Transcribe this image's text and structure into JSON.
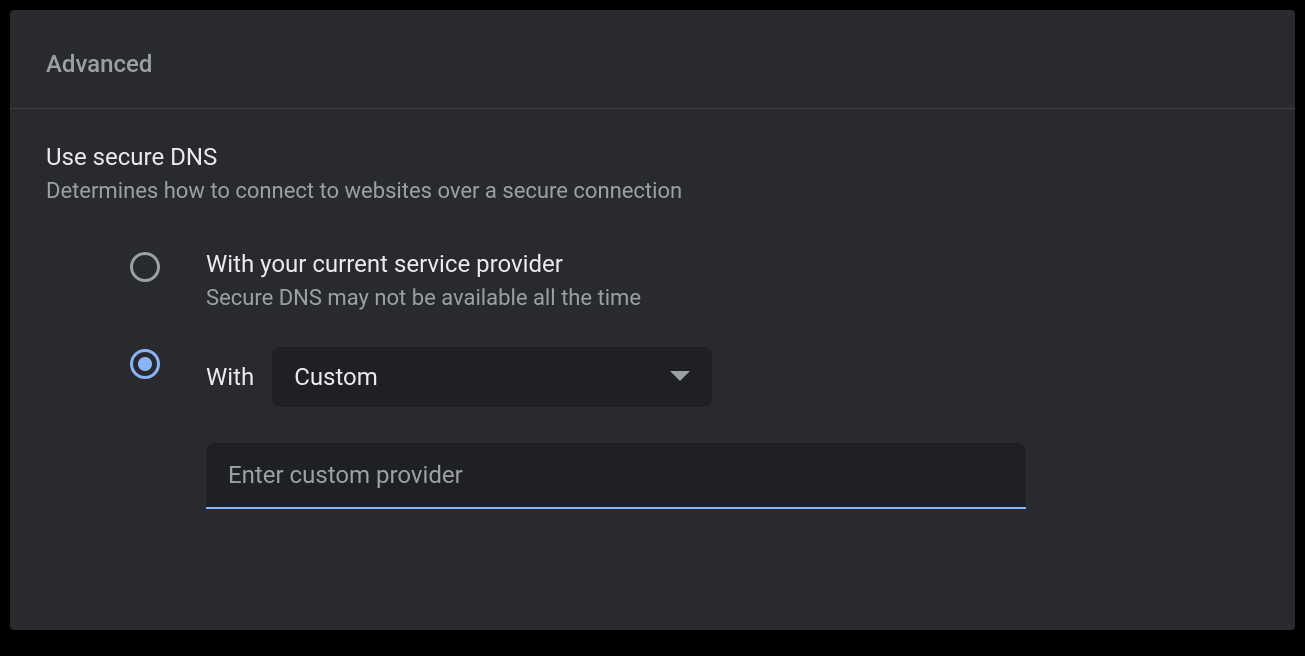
{
  "section": {
    "title": "Advanced"
  },
  "secure_dns": {
    "title": "Use secure DNS",
    "description": "Determines how to connect to websites over a secure connection",
    "options": {
      "current_provider": {
        "label": "With your current service provider",
        "sub": "Secure DNS may not be available all the time",
        "selected": false
      },
      "with": {
        "label": "With",
        "selected": true,
        "dropdown": {
          "value": "Custom"
        },
        "input": {
          "value": "",
          "placeholder": "Enter custom provider"
        }
      }
    }
  }
}
